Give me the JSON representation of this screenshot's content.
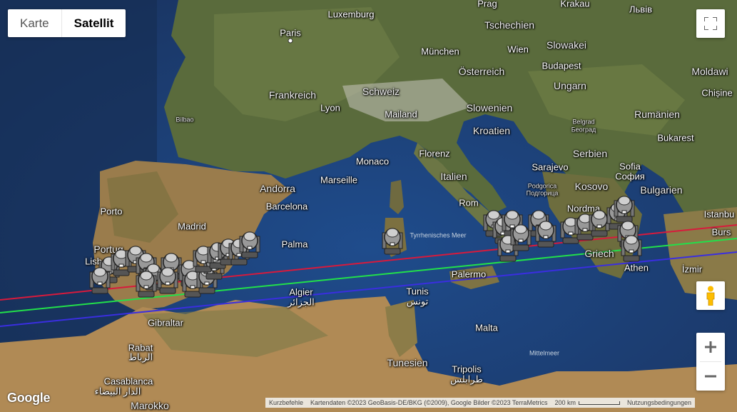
{
  "map_type": {
    "map_label": "Karte",
    "satellite_label": "Satellit",
    "active": "Satellit"
  },
  "labels": {
    "luxembourg": "Luxemburg",
    "prag": "Prag",
    "krakau": "Krakau",
    "lviv": "Львів",
    "paris": "Paris",
    "tschechien": "Tschechien",
    "munchen": "München",
    "wien": "Wien",
    "slowakei": "Slowakei",
    "osterreich": "Österreich",
    "budapest": "Budapest",
    "moldawien": "Moldawi",
    "frankreich": "Frankreich",
    "schweiz": "Schweiz",
    "ungarn": "Ungarn",
    "chisinau": "Chișine",
    "lyon": "Lyon",
    "mailand": "Mailand",
    "slowenien": "Slowenien",
    "rumanien": "Rumänien",
    "bilbao": "Bilbao",
    "belgrad": "Belgrad",
    "belgrad_cyr": "Београд",
    "kroatien": "Kroatien",
    "bukarest": "Bukarest",
    "florenz": "Florenz",
    "serbien": "Serbien",
    "monaco": "Monaco",
    "sarajevo": "Sarajevo",
    "sofia": "Sofia",
    "sofia_cyr": "София",
    "marseille": "Marseille",
    "italien": "Italien",
    "podgorica": "Podgorica",
    "podgorica_cyr": "Подгорица",
    "kosovo": "Kosovo",
    "bulgarien": "Bulgarien",
    "andorra": "Andorra",
    "rom": "Rom",
    "porto": "Porto",
    "barcelona": "Barcelona",
    "istanbul": "Istanbu",
    "madrid": "Madrid",
    "nordmazedonien": "Nordma",
    "bursa": "Burs",
    "portugal": "Portug",
    "lissabon": "Lisb",
    "palma": "Palma",
    "griechenland": "Griech",
    "tyrrhenisches": "Tyrrhenisches Meer",
    "izmir": "İzmir",
    "athen": "Athen",
    "palermo": "Palermo",
    "algier": "Algier",
    "algier_ar": "الجزائر",
    "tunis": "Tunis",
    "tunis_ar": "تونس",
    "gibraltar": "Gibraltar",
    "malta": "Malta",
    "mittelmeer": "Mittelmeer",
    "rabat": "Rabat",
    "rabat_ar": "الرباط",
    "tunesien": "Tunesien",
    "tripolis": "Tripolis",
    "tripolis_ar": "طرابلس",
    "casablanca": "Casablanca",
    "casablanca_ar": "الدار البيضاء",
    "marokko": "Marokko"
  },
  "attribution": {
    "google": "Google",
    "shortcuts": "Kurzbefehle",
    "map_data": "Kartendaten ©2023 GeoBasis-DE/BKG (©2009), Google Bilder ©2023 TerraMetrics",
    "scale": "200 km",
    "terms": "Nutzungsbedingungen"
  },
  "route_colors": {
    "red": "#d81a3c",
    "green": "#22e04a",
    "blue": "#3a2ee0"
  },
  "icons": [
    "fullscreen-icon",
    "pegman-icon",
    "zoom-in-icon",
    "zoom-out-icon",
    "moving-head-light-icon"
  ]
}
